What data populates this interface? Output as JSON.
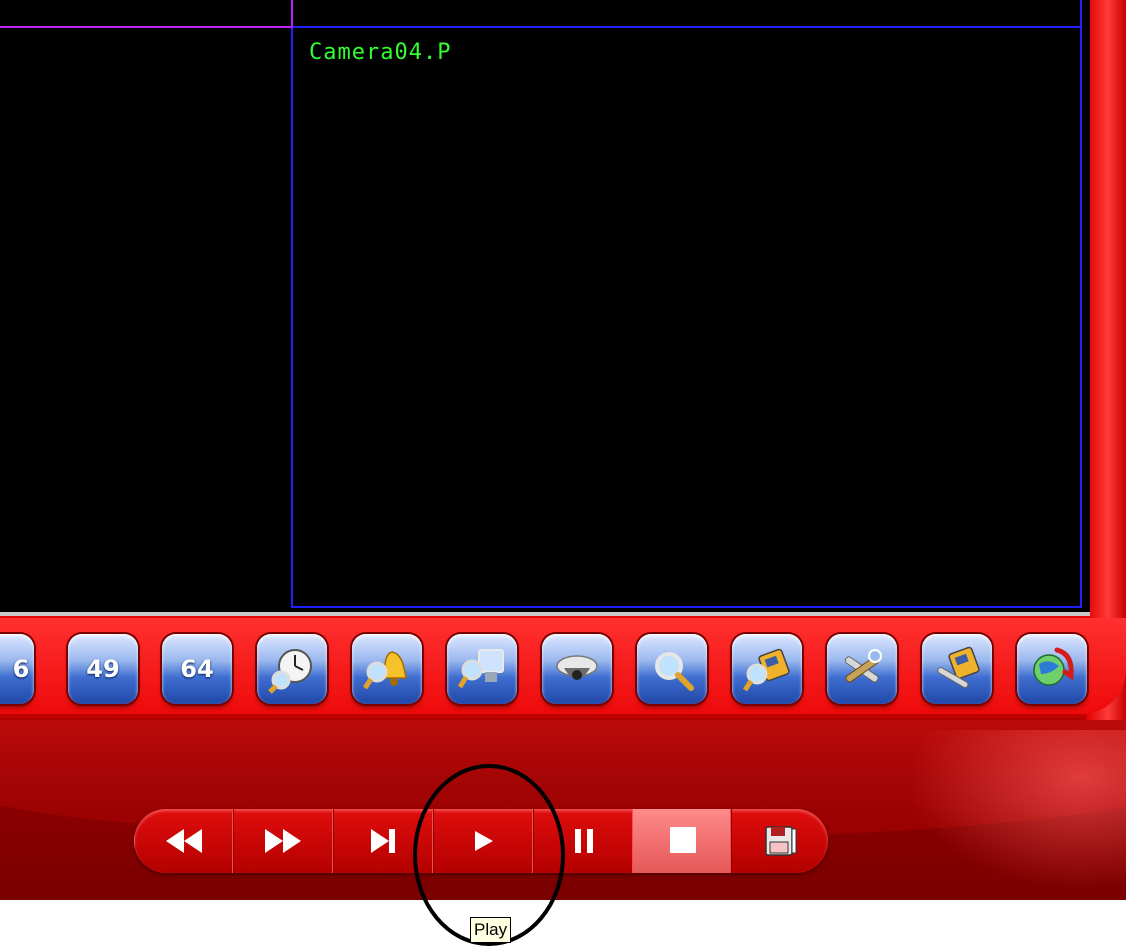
{
  "video_grid": {
    "main_camera_label": "Camera04.P"
  },
  "toolbar": {
    "buttons": [
      {
        "label": "6",
        "icon": "layout-16-icon"
      },
      {
        "label": "49",
        "icon": "layout-49-icon"
      },
      {
        "label": "64",
        "icon": "layout-64-icon"
      },
      {
        "label": "",
        "icon": "clock-search-icon"
      },
      {
        "label": "",
        "icon": "alarm-bell-search-icon"
      },
      {
        "label": "",
        "icon": "monitor-search-icon"
      },
      {
        "label": "",
        "icon": "dome-camera-icon"
      },
      {
        "label": "",
        "icon": "magnifier-icon"
      },
      {
        "label": "",
        "icon": "config-search-icon"
      },
      {
        "label": "",
        "icon": "tools-settings-icon"
      },
      {
        "label": "",
        "icon": "remote-config-icon"
      },
      {
        "label": "",
        "icon": "globe-exit-icon"
      }
    ]
  },
  "playback": {
    "buttons": [
      "rewind",
      "fast-forward",
      "step-forward",
      "play",
      "pause",
      "stop",
      "save-clip"
    ]
  },
  "tooltip": {
    "text": "Play"
  },
  "colors": {
    "frame_red": "#f20b0b",
    "camera_label_green": "#33ff33",
    "grid_line_blue": "#2020ff",
    "grid_line_purple": "#c020ff",
    "button_blue": "#3f6ed0"
  }
}
